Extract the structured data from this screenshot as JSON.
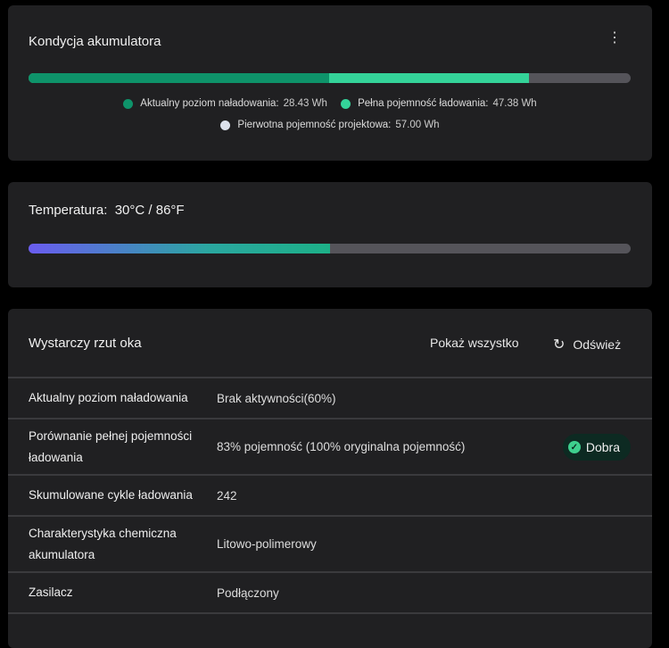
{
  "battery": {
    "title": "Kondycja akumulatora",
    "current_fraction": 0.499,
    "full_fraction": 0.831,
    "legend": [
      {
        "label": "Aktualny poziom naładowania:",
        "value": "28.43 Wh",
        "color": "#0e936a"
      },
      {
        "label": "Pełna pojemność ładowania:",
        "value": "47.38 Wh",
        "color": "#34d399"
      },
      {
        "label": "Pierwotna pojemność projektowa:",
        "value": "57.00 Wh",
        "color": "#dce1ec"
      }
    ]
  },
  "temperature": {
    "label": "Temperatura:",
    "value": "30°C / 86°F",
    "fill_fraction": 0.5
  },
  "glance": {
    "title": "Wystarczy rzut oka",
    "show_all": "Pokaż wszystko",
    "refresh": "Odśwież",
    "badge": "Dobra",
    "rows": [
      {
        "label": "Aktualny poziom naładowania",
        "value": "Brak aktywności(60%)"
      },
      {
        "label": "Porównanie pełnej pojemności ładowania",
        "value": "83% pojemność (100% oryginalna pojemność)"
      },
      {
        "label": "Skumulowane cykle ładowania",
        "value": "242"
      },
      {
        "label": "Charakterystyka chemiczna akumulatora",
        "value": "Litowo-polimerowy"
      },
      {
        "label": "Zasilacz",
        "value": "Podłączony"
      }
    ]
  }
}
